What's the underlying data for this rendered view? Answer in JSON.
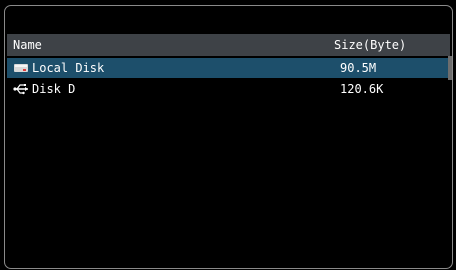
{
  "table": {
    "columns": {
      "name": "Name",
      "size": "Size(Byte)"
    },
    "rows": [
      {
        "name": "Local Disk",
        "size": "90.5M",
        "icon": "hard-disk-icon",
        "selected": true
      },
      {
        "name": "Disk D",
        "size": "120.6K",
        "icon": "usb-icon",
        "selected": false
      }
    ]
  },
  "colors": {
    "background": "#000000",
    "header": "#3e4247",
    "selected_row": "#1d4f6b",
    "text": "#ffffff"
  }
}
